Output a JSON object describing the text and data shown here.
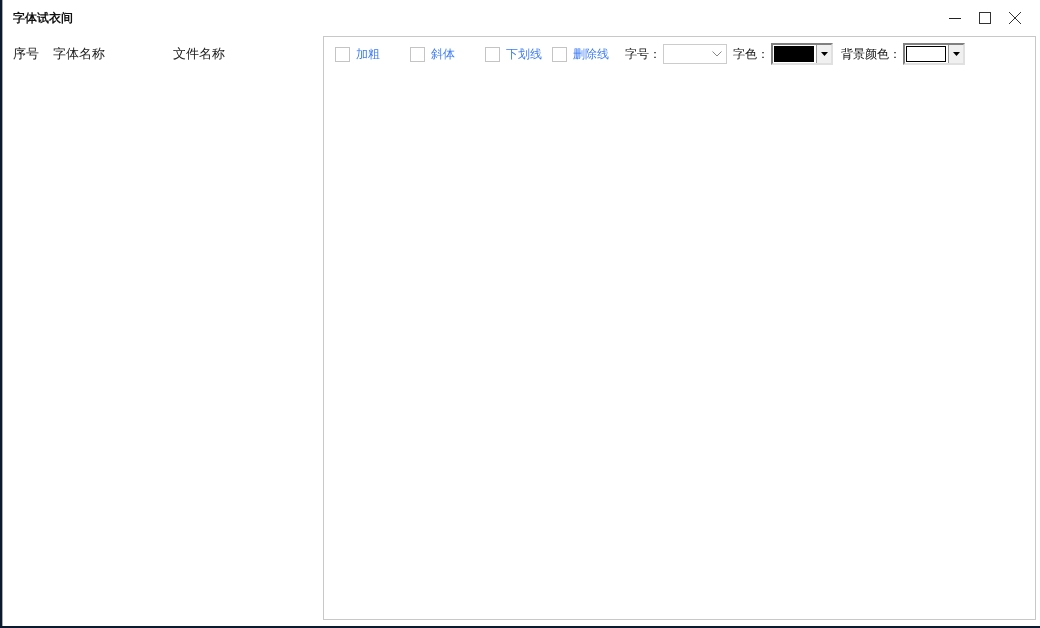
{
  "window": {
    "title": "字体试衣间"
  },
  "list": {
    "columns": [
      "序号",
      "字体名称",
      "文件名称"
    ]
  },
  "toolbar": {
    "checkboxes": [
      {
        "label": "加粗",
        "checked": false
      },
      {
        "label": "斜体",
        "checked": false
      },
      {
        "label": "下划线",
        "checked": false
      },
      {
        "label": "删除线",
        "checked": false
      }
    ],
    "size_label": "字号：",
    "color_pickers": [
      {
        "label": "字色：",
        "color": "#000000"
      },
      {
        "label": "背景颜色：",
        "color": "#ffffff"
      }
    ]
  }
}
